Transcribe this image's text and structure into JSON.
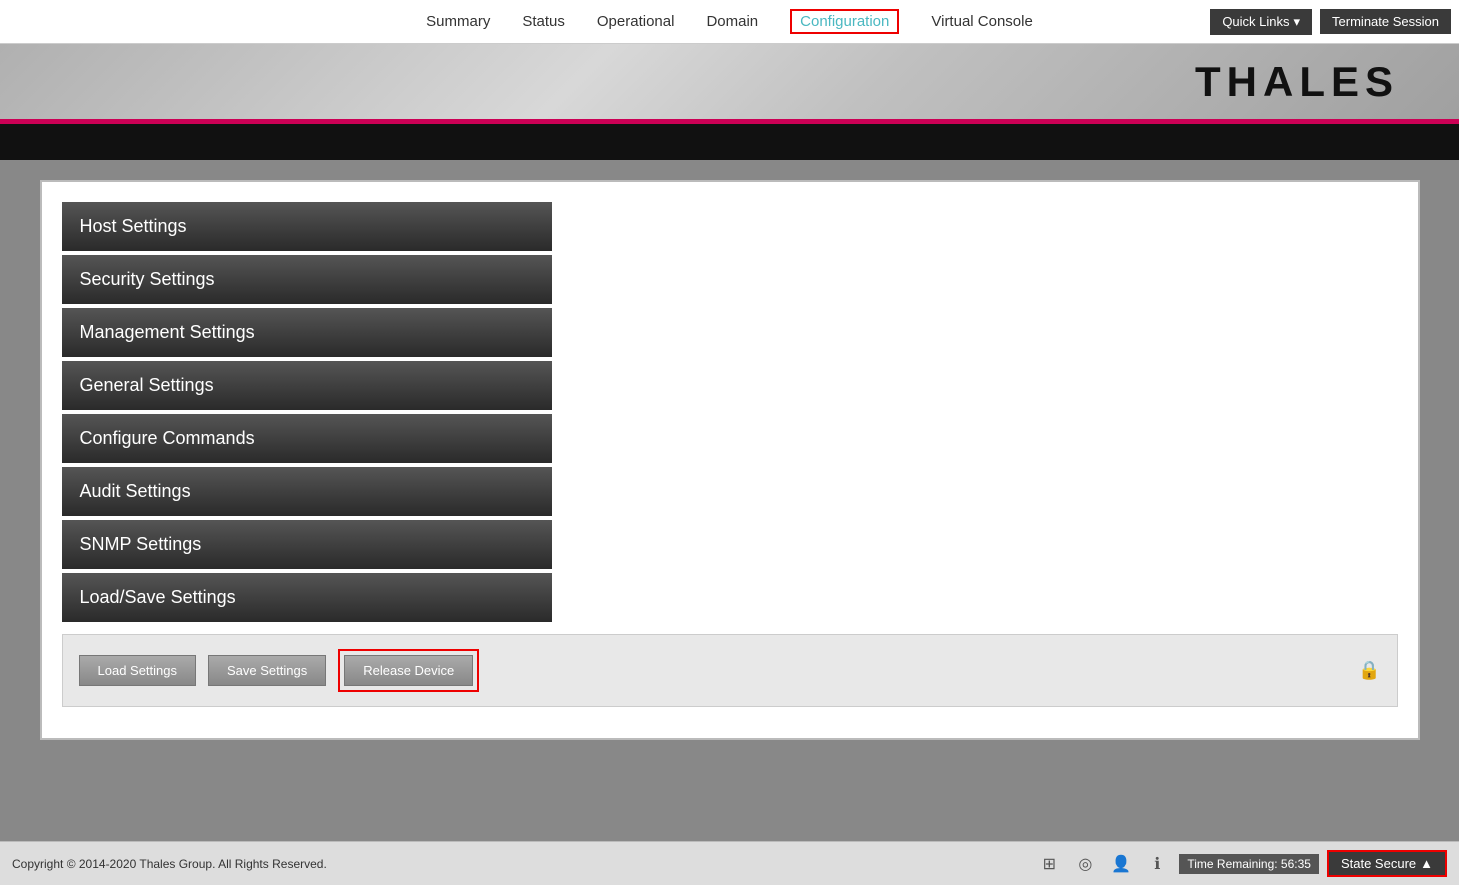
{
  "nav": {
    "links": [
      {
        "label": "Summary",
        "active": false
      },
      {
        "label": "Status",
        "active": false
      },
      {
        "label": "Operational",
        "active": false
      },
      {
        "label": "Domain",
        "active": false
      },
      {
        "label": "Configuration",
        "active": true
      },
      {
        "label": "Virtual Console",
        "active": false
      }
    ],
    "quick_links_label": "Quick Links",
    "terminate_label": "Terminate Session"
  },
  "logo": "THALES",
  "sidebar": {
    "items": [
      {
        "label": "Host Settings"
      },
      {
        "label": "Security Settings"
      },
      {
        "label": "Management Settings"
      },
      {
        "label": "General Settings"
      },
      {
        "label": "Configure Commands"
      },
      {
        "label": "Audit Settings"
      },
      {
        "label": "SNMP Settings"
      },
      {
        "label": "Load/Save Settings"
      }
    ]
  },
  "actions": {
    "load_label": "Load Settings",
    "save_label": "Save Settings",
    "release_label": "Release Device"
  },
  "footer": {
    "copyright": "Copyright © 2014-2020 Thales Group. All Rights Reserved.",
    "time_remaining_label": "Time Remaining: 56:35",
    "state_label": "State Secure"
  }
}
